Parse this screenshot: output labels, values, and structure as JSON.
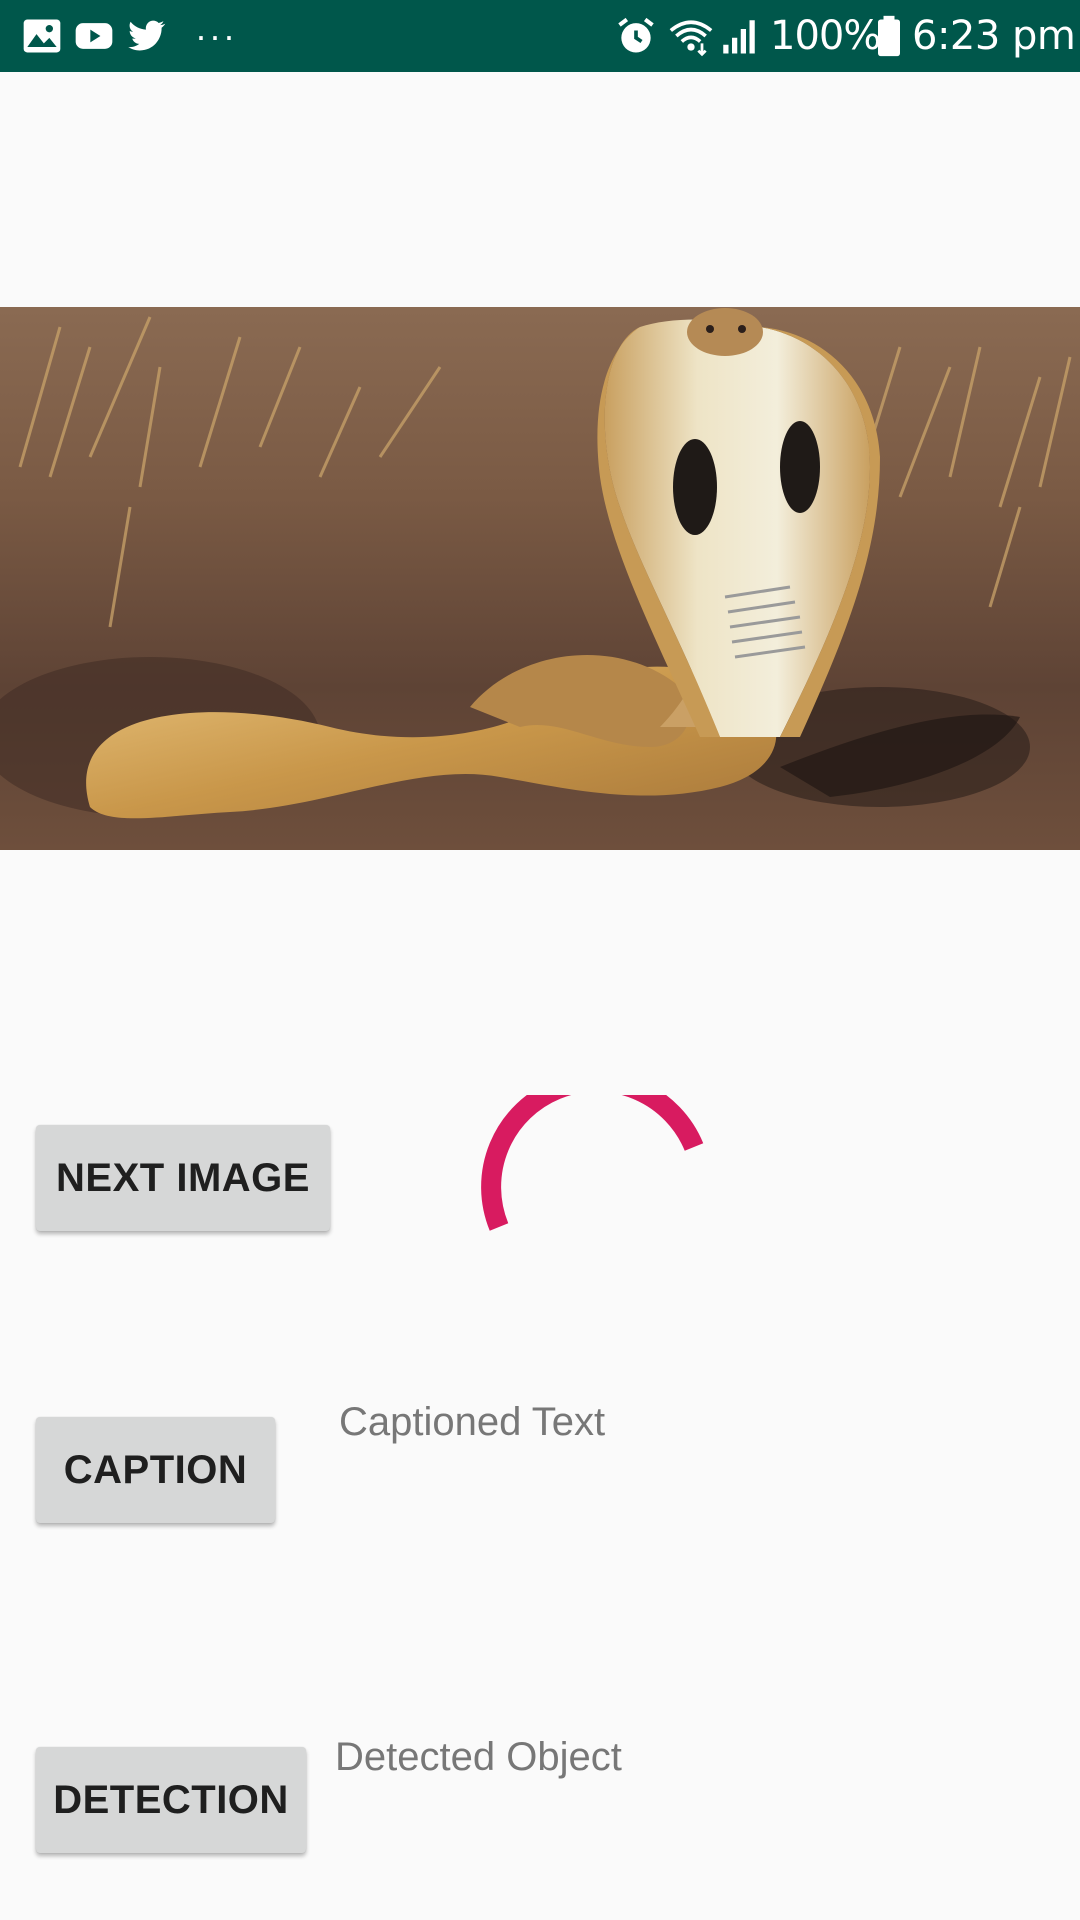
{
  "status_bar": {
    "background": "#00574b",
    "left_icons": [
      "gallery-icon",
      "youtube-icon",
      "twitter-icon",
      "more-notifications-icon"
    ],
    "more_label": "···",
    "right_icons": [
      "alarm-icon",
      "wifi-icon",
      "signal-icon",
      "battery-icon"
    ],
    "battery_percent": "100%",
    "time": "6:23 pm"
  },
  "main": {
    "image": {
      "subject": "cobra-photo"
    },
    "buttons": {
      "next_image": "NEXT IMAGE",
      "caption": "CAPTION",
      "detection": "DETECTION"
    },
    "caption_text": "Captioned Text",
    "detected_object_text": "Detected Object",
    "spinner_color": "#d81b60"
  }
}
